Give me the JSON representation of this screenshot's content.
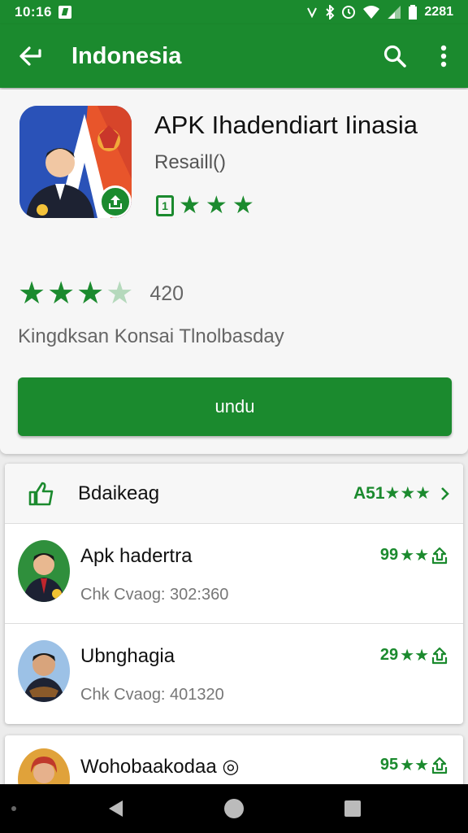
{
  "status_bar": {
    "time": "10:16",
    "right_text": "2281"
  },
  "app_bar": {
    "title": "Indonesia"
  },
  "app": {
    "name": "APK Ihadendiart Iinasia",
    "developer": "Resaill()",
    "rating_value": "420",
    "rating_stars": 3,
    "summary": "Kingdksan Konsai Tlnolbasday",
    "install_label": "undu"
  },
  "list": {
    "header_title": "Bdaikeag",
    "header_meta": "A51",
    "items": [
      {
        "name": "Apk hadertra",
        "subtitle": "Chk Cvaog: 302:360",
        "score": "99"
      },
      {
        "name": "Ubnghagia",
        "subtitle": "Chk Cvaog: 401320",
        "score": "29"
      },
      {
        "name": "Wohobaakodaa",
        "score": "95"
      }
    ]
  },
  "colors": {
    "primary": "#1b8a2e",
    "star_light": "#b5d9bc"
  }
}
